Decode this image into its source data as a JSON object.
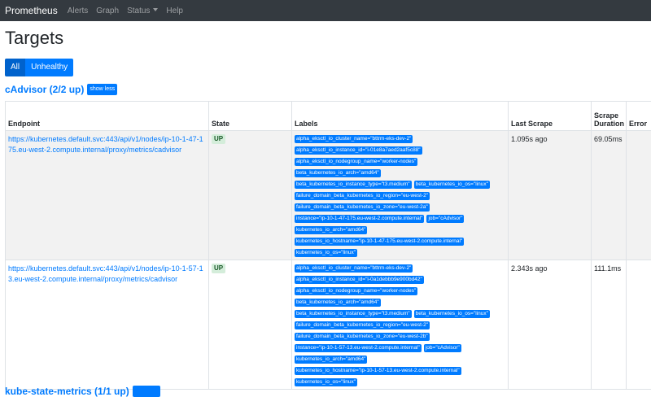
{
  "navbar": {
    "brand": "Prometheus",
    "links": [
      "Alerts",
      "Graph",
      "Status",
      "Help"
    ]
  },
  "page": {
    "title": "Targets"
  },
  "filters": {
    "all": "All",
    "unhealthy": "Unhealthy"
  },
  "section": {
    "title": "cAdvisor (2/2 up)",
    "toggle": "show less"
  },
  "table": {
    "headers": {
      "endpoint": "Endpoint",
      "state": "State",
      "labels": "Labels",
      "last_scrape": "Last Scrape",
      "scrape_duration": "Scrape Duration",
      "error": "Error"
    },
    "rows": [
      {
        "endpoint": "https://kubernetes.default.svc:443/api/v1/nodes/ip-10-1-47-175.eu-west-2.compute.internal/proxy/metrics/cadvisor",
        "state": "UP",
        "labels": [
          "alpha_eksctl_io_cluster_name=\"bttrm-eks-dev-2\"",
          "alpha_eksctl_io_instance_id=\"i-01e8a7aed2aaf5c88\"",
          "alpha_eksctl_io_nodegroup_name=\"worker-nodes\"",
          "beta_kubernetes_io_arch=\"amd64\"",
          "beta_kubernetes_io_instance_type=\"t3.medium\"",
          "beta_kubernetes_io_os=\"linux\"",
          "failure_domain_beta_kubernetes_io_region=\"eu-west-2\"",
          "failure_domain_beta_kubernetes_io_zone=\"eu-west-2a\"",
          "instance=\"ip-10-1-47-175.eu-west-2.compute.internal\"",
          "job=\"cAdvisor\"",
          "kubernetes_io_arch=\"amd64\"",
          "kubernetes_io_hostname=\"ip-10-1-47-175.eu-west-2.compute.internal\"",
          "kubernetes_io_os=\"linux\""
        ],
        "last_scrape": "1.095s ago",
        "duration": "69.05ms",
        "error": ""
      },
      {
        "endpoint": "https://kubernetes.default.svc:443/api/v1/nodes/ip-10-1-57-13.eu-west-2.compute.internal/proxy/metrics/cadvisor",
        "state": "UP",
        "labels": [
          "alpha_eksctl_io_cluster_name=\"bttrm-eks-dev-2\"",
          "alpha_eksctl_io_instance_id=\"i-0a1debbb9e900bd42\"",
          "alpha_eksctl_io_nodegroup_name=\"worker-nodes\"",
          "beta_kubernetes_io_arch=\"amd64\"",
          "beta_kubernetes_io_instance_type=\"t3.medium\"",
          "beta_kubernetes_io_os=\"linux\"",
          "failure_domain_beta_kubernetes_io_region=\"eu-west-2\"",
          "failure_domain_beta_kubernetes_io_zone=\"eu-west-2b\"",
          "instance=\"ip-10-1-57-13.eu-west-2.compute.internal\"",
          "job=\"cAdvisor\"",
          "kubernetes_io_arch=\"amd64\"",
          "kubernetes_io_hostname=\"ip-10-1-57-13.eu-west-2.compute.internal\"",
          "kubernetes_io_os=\"linux\""
        ],
        "last_scrape": "2.343s ago",
        "duration": "111.1ms",
        "error": ""
      }
    ]
  },
  "next_section": {
    "title": "kube-state-metrics (1/1 up)"
  }
}
